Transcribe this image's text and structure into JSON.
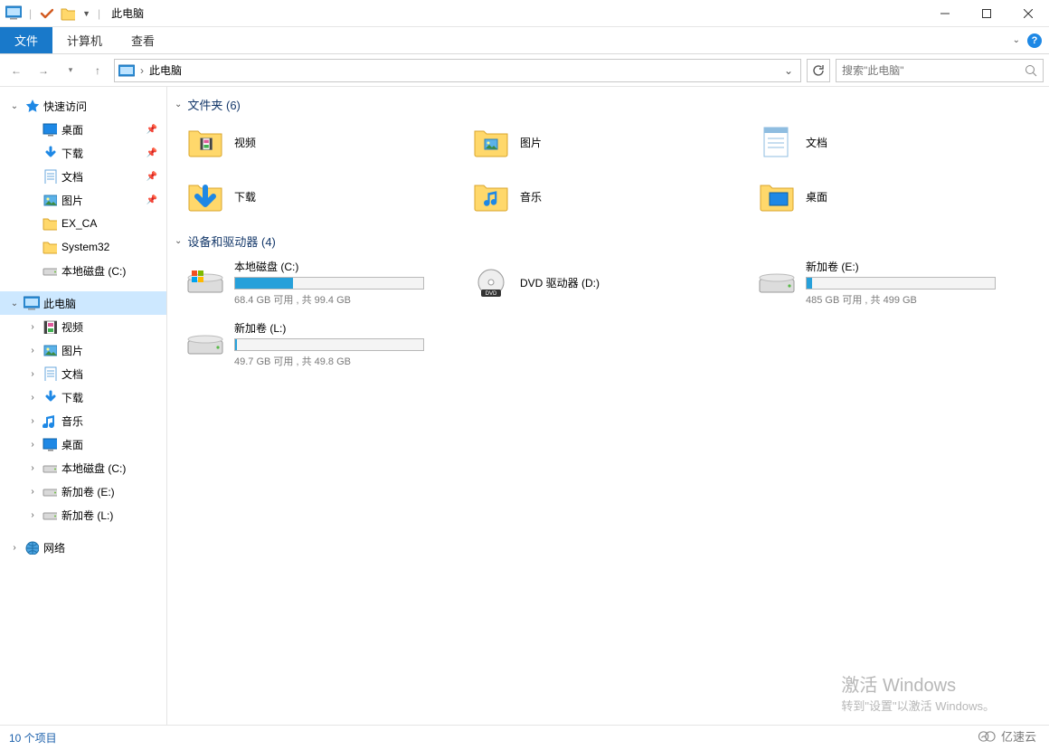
{
  "window": {
    "title": "此电脑"
  },
  "ribbon": {
    "file": "文件",
    "computer": "计算机",
    "view": "查看"
  },
  "addr": {
    "location": "此电脑",
    "search_placeholder": "搜索\"此电脑\""
  },
  "sidebar": {
    "quick_access": "快速访问",
    "quick_items": [
      {
        "label": "桌面",
        "icon": "desktop",
        "pinned": true
      },
      {
        "label": "下载",
        "icon": "download",
        "pinned": true
      },
      {
        "label": "文档",
        "icon": "document",
        "pinned": true
      },
      {
        "label": "图片",
        "icon": "picture",
        "pinned": true
      },
      {
        "label": "EX_CA",
        "icon": "folder",
        "pinned": false
      },
      {
        "label": "System32",
        "icon": "folder",
        "pinned": false
      },
      {
        "label": "本地磁盘 (C:)",
        "icon": "drive",
        "pinned": false
      }
    ],
    "this_pc": "此电脑",
    "this_pc_children": [
      {
        "label": "视频",
        "icon": "video"
      },
      {
        "label": "图片",
        "icon": "picture"
      },
      {
        "label": "文档",
        "icon": "document"
      },
      {
        "label": "下载",
        "icon": "download"
      },
      {
        "label": "音乐",
        "icon": "music"
      },
      {
        "label": "桌面",
        "icon": "desktop"
      },
      {
        "label": "本地磁盘 (C:)",
        "icon": "drive"
      },
      {
        "label": "新加卷 (E:)",
        "icon": "drive"
      },
      {
        "label": "新加卷 (L:)",
        "icon": "drive"
      }
    ],
    "network": "网络"
  },
  "content": {
    "folders_header": "文件夹 (6)",
    "folders": [
      {
        "label": "视频",
        "icon": "video"
      },
      {
        "label": "图片",
        "icon": "picture"
      },
      {
        "label": "文档",
        "icon": "document"
      },
      {
        "label": "下载",
        "icon": "download"
      },
      {
        "label": "音乐",
        "icon": "music"
      },
      {
        "label": "桌面",
        "icon": "desktop"
      }
    ],
    "devices_header": "设备和驱动器 (4)",
    "drives": [
      {
        "name": "本地磁盘 (C:)",
        "text": "68.4 GB 可用 , 共 99.4 GB",
        "fill_pct": 31,
        "icon": "os-drive"
      },
      {
        "name": "DVD 驱动器 (D:)",
        "text": "",
        "fill_pct": null,
        "icon": "dvd"
      },
      {
        "name": "新加卷 (E:)",
        "text": "485 GB 可用 , 共 499 GB",
        "fill_pct": 3,
        "icon": "hdd"
      },
      {
        "name": "新加卷 (L:)",
        "text": "49.7 GB 可用 , 共 49.8 GB",
        "fill_pct": 1,
        "icon": "hdd"
      }
    ]
  },
  "statusbar": {
    "items": "10 个项目"
  },
  "watermark": {
    "line1": "激活 Windows",
    "line2": "转到\"设置\"以激活 Windows。"
  },
  "brand": {
    "text": "亿速云"
  }
}
